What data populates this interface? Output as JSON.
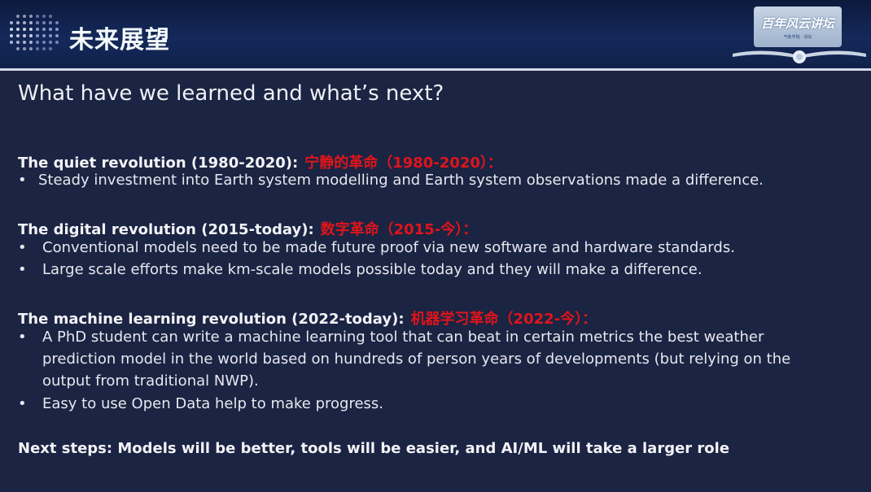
{
  "header": {
    "title": "未来展望",
    "logo_text": "百年风云讲坛",
    "logo_subtext": "气象学院 · 讲坛"
  },
  "slide": {
    "title": "What have we learned and what’s next?",
    "sections": [
      {
        "heading": "The quiet revolution (1980-2020):",
        "heading_cn": "宁静的革命（1980-2020）：",
        "bullets": [
          "Steady investment into Earth system modelling and Earth system observations made a difference."
        ]
      },
      {
        "heading": "The digital revolution (2015-today):",
        "heading_cn": "数字革命（2015-今）：",
        "bullets": [
          "Conventional models need to be made future proof via new software and hardware standards.",
          "Large scale efforts make km-scale models possible today and they will make a difference."
        ]
      },
      {
        "heading": "The machine learning revolution (2022-today):",
        "heading_cn": "机器学习革命（2022-今）：",
        "bullets": [
          "A PhD student can write a machine learning tool that can beat in certain metrics the best weather",
          "prediction model in the world based on hundreds of person years of developments (but relying on the",
          "output from traditional NWP).",
          "Easy to use Open Data help to make progress."
        ]
      }
    ],
    "next_steps": "Next steps: Models will be better, tools will be easier, and AI/ML will take a larger role",
    "bullet_mark": "•"
  },
  "colors": {
    "background": "#1b2442",
    "header": "#10224b",
    "accent_red": "#e0141b",
    "text": "#e6e8ef"
  }
}
